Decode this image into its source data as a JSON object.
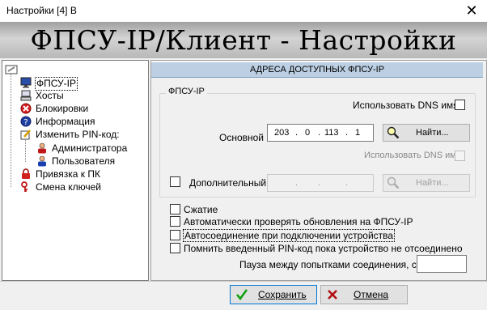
{
  "window": {
    "title": "Настройки [4] B",
    "close_glyph": "✕"
  },
  "banner": {
    "title": "ФПСУ-IP/Клиент - Настройки"
  },
  "tree": {
    "items": [
      {
        "label": "ФПСУ-IP",
        "icon": "monitor-icon"
      },
      {
        "label": "Хосты",
        "icon": "computer-icon"
      },
      {
        "label": "Блокировки",
        "icon": "block-icon"
      },
      {
        "label": "Информация",
        "icon": "info-icon"
      },
      {
        "label": "Изменить PIN-код:",
        "icon": "edit-pin-icon"
      },
      {
        "label": "Администратора",
        "icon": "user-icon"
      },
      {
        "label": "Пользователя",
        "icon": "user-icon"
      },
      {
        "label": "Привязка к ПК",
        "icon": "lock-icon"
      },
      {
        "label": "Смена ключей",
        "icon": "key-icon"
      }
    ]
  },
  "section": {
    "header": "АДРЕСА ДОСТУПНЫХ ФПСУ-IP",
    "group_label": "ФПСУ-IP",
    "use_dns_label": "Использовать DNS имя",
    "primary": {
      "label": "Основной",
      "ip": [
        "203",
        "0",
        "113",
        "1"
      ],
      "find_label": "Найти..."
    },
    "use_dns2_label": "Использовать DNS имя",
    "secondary": {
      "label": "Дополнительный",
      "ip": [
        "",
        "",
        "",
        ""
      ],
      "find_label": "Найти..."
    },
    "dot": "."
  },
  "options": [
    "Сжатие",
    "Автоматически проверять обновления на ФПСУ-IP",
    "Автосоединение при подключении устройства",
    "Помнить введенный PIN-код пока устройство не отсоединено"
  ],
  "pause": {
    "label": "Пауза между попытками соединения, сек",
    "value": ""
  },
  "footer": {
    "save_label": "Сохранить",
    "cancel_label": "Отмена"
  },
  "colors": {
    "header_bg": "#bccfe3",
    "accent": "#0078d7"
  }
}
